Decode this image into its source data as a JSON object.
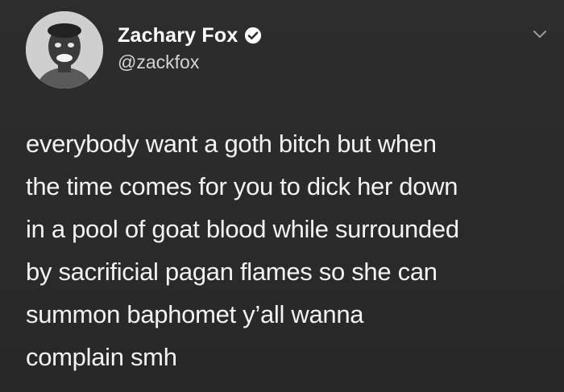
{
  "author": {
    "display_name": "Zachary Fox",
    "handle": "@zackfox",
    "verified": true,
    "avatar_icon": "profile-photo"
  },
  "tweet": {
    "text": "everybody want a goth bitch but when\nthe time comes for you to dick her down\nin a pool of goat blood while surrounded\nby sacrificial pagan flames so she can\nsummon baphomet y’all wanna\ncomplain smh"
  },
  "menu": {
    "icon": "chevron-down-icon"
  },
  "colors": {
    "background": "#2b2b2b",
    "text": "#f2f2f2",
    "handle": "#d3d3d3"
  }
}
